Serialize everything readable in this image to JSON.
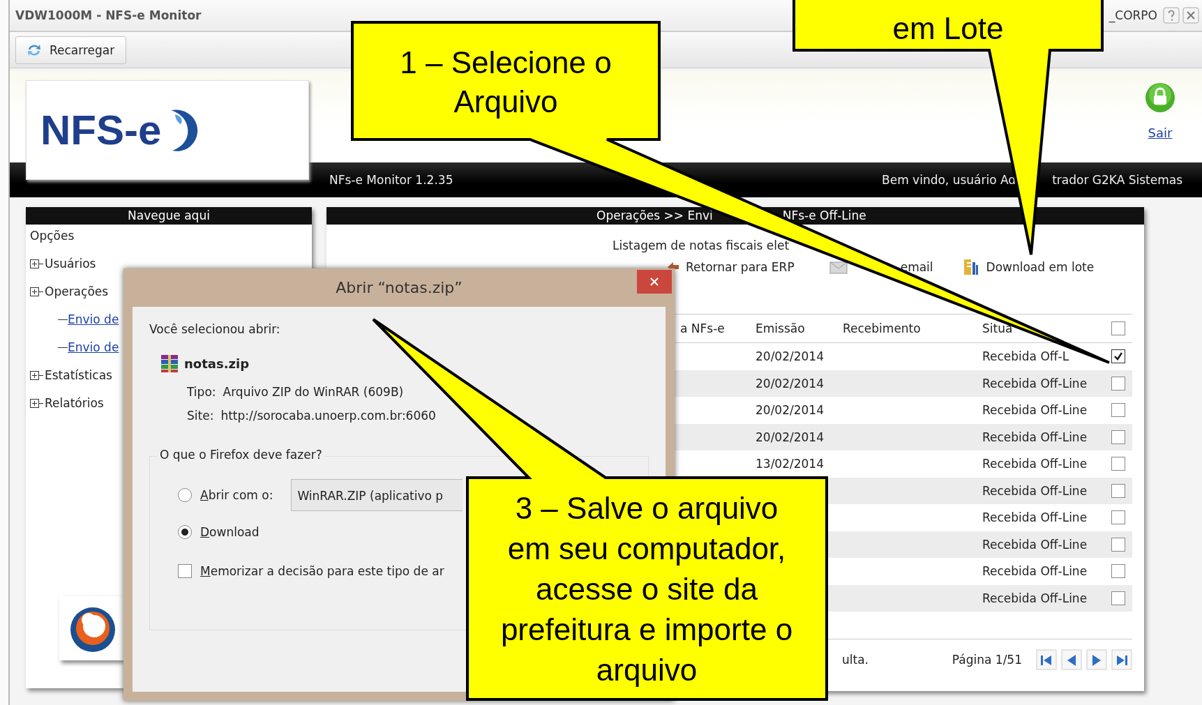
{
  "window": {
    "title": "VDW1000M - NFS-e Monitor",
    "corner_label": "_CORPO"
  },
  "toolbar": {
    "reload_button": "Recarregar"
  },
  "header": {
    "logo_text": "NFS-e",
    "logout_link": "Sair"
  },
  "banner": {
    "version": "NFs-e Monitor 1.2.35",
    "welcome_parts": [
      "Bem vindo, usuário Ad",
      "trador G2KA Sistemas"
    ]
  },
  "sidebar": {
    "title": "Navegue aqui",
    "root": "Opções",
    "items": [
      {
        "label": "Usuários"
      },
      {
        "label": "Operações",
        "children": [
          {
            "label": "Envio de"
          },
          {
            "label": "Envio de"
          }
        ]
      },
      {
        "label": "Estatísticas"
      },
      {
        "label": "Relatórios"
      }
    ]
  },
  "operations": {
    "title_parts": [
      "Operações >> Envi",
      "NFs-e Off-Line"
    ],
    "subtitle": "Listagem de notas fiscais elet",
    "actions": [
      {
        "label": "Retornar para ERP",
        "kind": "erp"
      },
      {
        "label": "email",
        "kind": "email"
      },
      {
        "label": "Download em lote",
        "kind": "download"
      }
    ],
    "table": {
      "columns": [
        "a NFs-e",
        "Emissão",
        "Recebimento",
        "Situa"
      ],
      "select_all_checked": false,
      "rows": [
        {
          "emission": "20/02/2014",
          "status": "Recebida Off-L",
          "checked": true
        },
        {
          "emission": "20/02/2014",
          "status": "Recebida Off-Line",
          "checked": false
        },
        {
          "emission": "20/02/2014",
          "status": "Recebida Off-Line",
          "checked": false
        },
        {
          "emission": "20/02/2014",
          "status": "Recebida Off-Line",
          "checked": false
        },
        {
          "emission": "13/02/2014",
          "status": "Recebida Off-Line",
          "checked": false
        },
        {
          "status": "Recebida Off-Line",
          "checked": false
        },
        {
          "status": "Recebida Off-Line",
          "checked": false
        },
        {
          "status": "Recebida Off-Line",
          "checked": false
        },
        {
          "status": "Recebida Off-Line",
          "checked": false
        },
        {
          "status": "Recebida Off-Line",
          "checked": false
        }
      ]
    },
    "footer_text": "ulta.",
    "page": "Página 1/51"
  },
  "dialog": {
    "title": "Abrir “notas.zip”",
    "intro": "Você selecionou abrir:",
    "file_name": "notas.zip",
    "type_label": "Tipo:",
    "type_value": "Arquivo ZIP do WinRAR (609B)",
    "site_label": "Site:",
    "site_value": "http://sorocaba.unoerp.com.br:6060",
    "group_title": "O que o Firefox deve fazer?",
    "options": [
      {
        "label": "Abrir com o:",
        "selected": false
      },
      {
        "label": "Download",
        "selected": true
      }
    ],
    "app_select": "WinRAR.ZIP (aplicativo p",
    "remember": {
      "label": "Memorizar a decisão para este tipo de ar",
      "checked": false
    }
  },
  "callouts": [
    {
      "text": "1 – Selecione o Arquivo"
    },
    {
      "text": "em Lote"
    },
    {
      "text": "3 – Salve o arquivo em seu computador, acesse o site da prefeitura e importe o arquivo"
    }
  ]
}
